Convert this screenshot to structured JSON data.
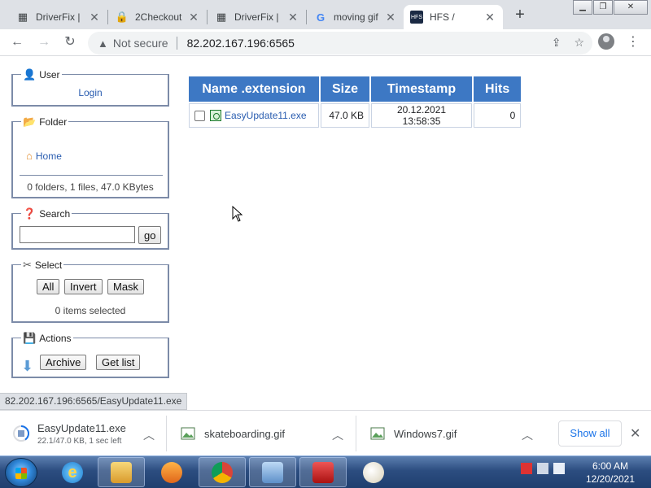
{
  "browser": {
    "tabs": [
      {
        "title": "DriverFix |",
        "icon": "driverfix-icon",
        "active": false
      },
      {
        "title": "2Checkout",
        "icon": "lock-icon",
        "active": false
      },
      {
        "title": "DriverFix |",
        "icon": "driverfix-icon",
        "active": false
      },
      {
        "title": "moving gif",
        "icon": "google-icon",
        "active": false
      },
      {
        "title": "HFS /",
        "icon": "hfs-icon",
        "active": true
      }
    ],
    "address": {
      "security": "Not secure",
      "url": "82.202.167.196:6565"
    },
    "status_url": "82.202.167.196:6565/EasyUpdate11.exe"
  },
  "page": {
    "user": {
      "legend": "User",
      "login": "Login"
    },
    "folder": {
      "legend": "Folder",
      "home": "Home",
      "summary": "0 folders, 1 files, 47.0 KBytes"
    },
    "search": {
      "legend": "Search",
      "go": "go",
      "value": ""
    },
    "select": {
      "legend": "Select",
      "all": "All",
      "invert": "Invert",
      "mask": "Mask",
      "summary": "0 items selected"
    },
    "actions": {
      "legend": "Actions",
      "archive": "Archive",
      "get_list": "Get list"
    },
    "table": {
      "headers": [
        "Name .extension",
        "Size",
        "Timestamp",
        "Hits"
      ],
      "rows": [
        {
          "name": "EasyUpdate11.exe",
          "size": "47.0 KB",
          "timestamp": "20.12.2021 13:58:35",
          "hits": "0"
        }
      ]
    }
  },
  "downloads": {
    "items": [
      {
        "name": "EasyUpdate11.exe",
        "status": "22.1/47.0 KB, 1 sec left"
      },
      {
        "name": "skateboarding.gif",
        "status": ""
      },
      {
        "name": "Windows7.gif",
        "status": ""
      }
    ],
    "show_all": "Show all"
  },
  "taskbar": {
    "time": "6:00 AM",
    "date": "12/20/2021"
  }
}
